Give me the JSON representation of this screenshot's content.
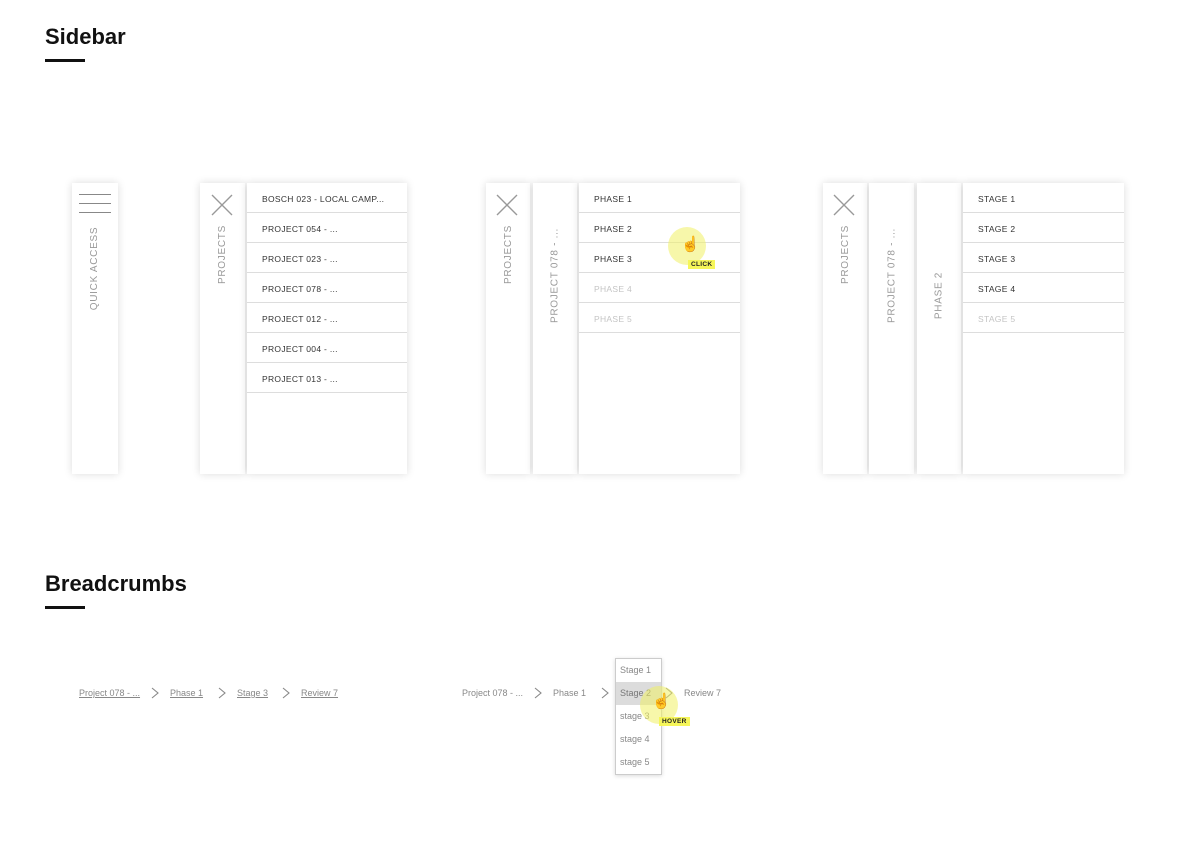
{
  "sidebar_section": {
    "title": "Sidebar"
  },
  "breadcrumbs_section": {
    "title": "Breadcrumbs"
  },
  "state1": {
    "label": "QUICK ACCESS"
  },
  "state2": {
    "label": "PROJECTS",
    "items": [
      "BOSCH 023 - LOCAL CAMP...",
      "PROJECT 054 - ...",
      "PROJECT 023 - ...",
      "PROJECT 078 - ...",
      "PROJECT 012 - ...",
      "PROJECT 004 - ...",
      "PROJECT 013 - ..."
    ]
  },
  "state3": {
    "label1": "PROJECTS",
    "label2": "PROJECT 078 - ...",
    "items": [
      "PHASE 1",
      "PHASE 2",
      "PHASE 3",
      "PHASE 4",
      "PHASE 5"
    ],
    "cursor_tag": "CLICK"
  },
  "state4": {
    "label1": "PROJECTS",
    "label2": "PROJECT 078 - ...",
    "label3": "PHASE 2",
    "items": [
      "STAGE 1",
      "STAGE 2",
      "STAGE 3",
      "STAGE 4",
      "STAGE 5"
    ]
  },
  "breadcrumb1": [
    "Project 078 - ...",
    "Phase 1",
    "Stage 3",
    "Review 7"
  ],
  "breadcrumb2": {
    "items": [
      "Project 078 - ...",
      "Phase 1",
      "Stage 2",
      "Review 7"
    ],
    "dropdown": [
      "Stage 1",
      "Stage 2",
      "stage 3",
      "stage 4",
      "stage 5"
    ],
    "cursor_tag": "HOVER"
  }
}
